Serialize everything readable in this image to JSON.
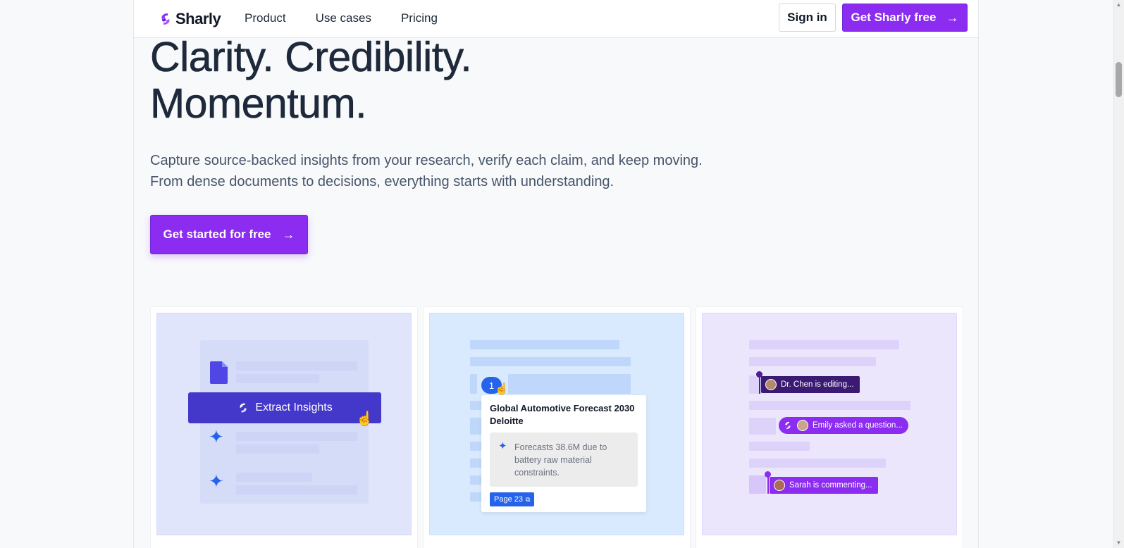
{
  "nav": {
    "brand": "Sharly",
    "links": [
      "Product",
      "Use cases",
      "Pricing"
    ],
    "sign_in": "Sign in",
    "cta": "Get Sharly free"
  },
  "hero": {
    "headline_line1": "Clarity. Credibility.",
    "headline_line2": "Momentum.",
    "subtext_line1": "Capture source-backed insights from your research, verify each claim, and keep moving.",
    "subtext_line2": "From dense documents to decisions, everything starts with understanding.",
    "cta": "Get started for free"
  },
  "cards": {
    "extract": {
      "button_label": "Extract Insights"
    },
    "citation": {
      "badge": "1",
      "title": "Global Automotive Forecast 2030 Deloitte",
      "quote": "Forecasts 38.6M due to battery raw material constraints.",
      "page_tag": "Page 23"
    },
    "collab": {
      "pill1": "Dr. Chen is editing...",
      "pill2": "Emily asked a question...",
      "pill3": "Sarah is commenting..."
    }
  },
  "colors": {
    "brand": "#8b2cf0",
    "extract_button": "#4338ca",
    "citation_blue": "#2563eb",
    "pill_dark": "#3b1a73",
    "pill_purple": "#8b2cf0"
  }
}
